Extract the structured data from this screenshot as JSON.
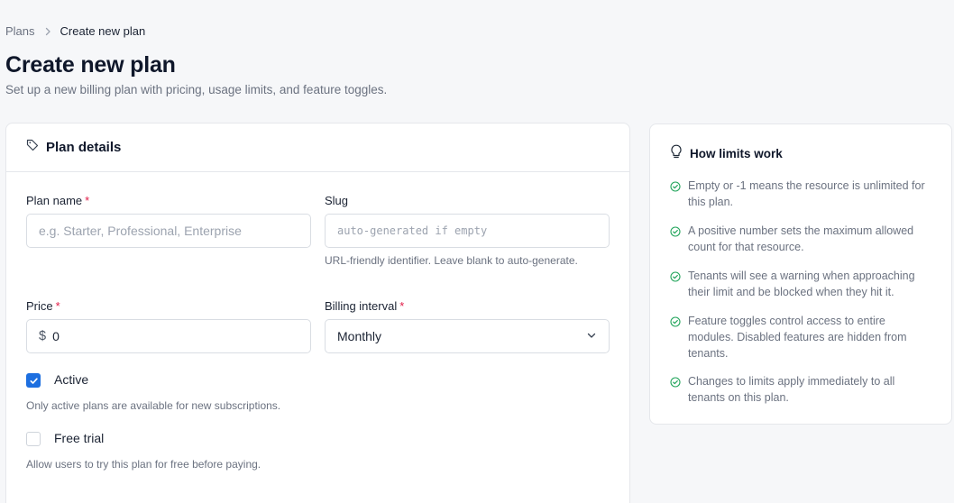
{
  "breadcrumb": {
    "parent": "Plans",
    "current": "Create new plan"
  },
  "header": {
    "title": "Create new plan",
    "subtitle": "Set up a new billing plan with pricing, usage limits, and feature toggles."
  },
  "plan_details": {
    "title": "Plan details",
    "plan_name": {
      "label": "Plan name",
      "required_mark": "*",
      "placeholder": "e.g. Starter, Professional, Enterprise",
      "value": ""
    },
    "slug": {
      "label": "Slug",
      "placeholder": "auto-generated if empty",
      "value": "",
      "help": "URL-friendly identifier. Leave blank to auto-generate."
    },
    "price": {
      "label": "Price",
      "required_mark": "*",
      "prefix": "$",
      "value": "0"
    },
    "billing_interval": {
      "label": "Billing interval",
      "required_mark": "*",
      "selected": "Monthly"
    },
    "active": {
      "label": "Active",
      "checked": true,
      "help": "Only active plans are available for new subscriptions."
    },
    "free_trial": {
      "label": "Free trial",
      "checked": false,
      "help": "Allow users to try this plan for free before paying."
    }
  },
  "limits_info": {
    "title": "How limits work",
    "tips": [
      "Empty or -1 means the resource is unlimited for this plan.",
      "A positive number sets the maximum allowed count for that resource.",
      "Tenants will see a warning when approaching their limit and be blocked when they hit it.",
      "Feature toggles control access to entire modules. Disabled features are hidden from tenants.",
      "Changes to limits apply immediately to all tenants on this plan."
    ]
  },
  "colors": {
    "accent": "#1d6fe0",
    "success": "#22a55b",
    "required": "#e11d48"
  }
}
